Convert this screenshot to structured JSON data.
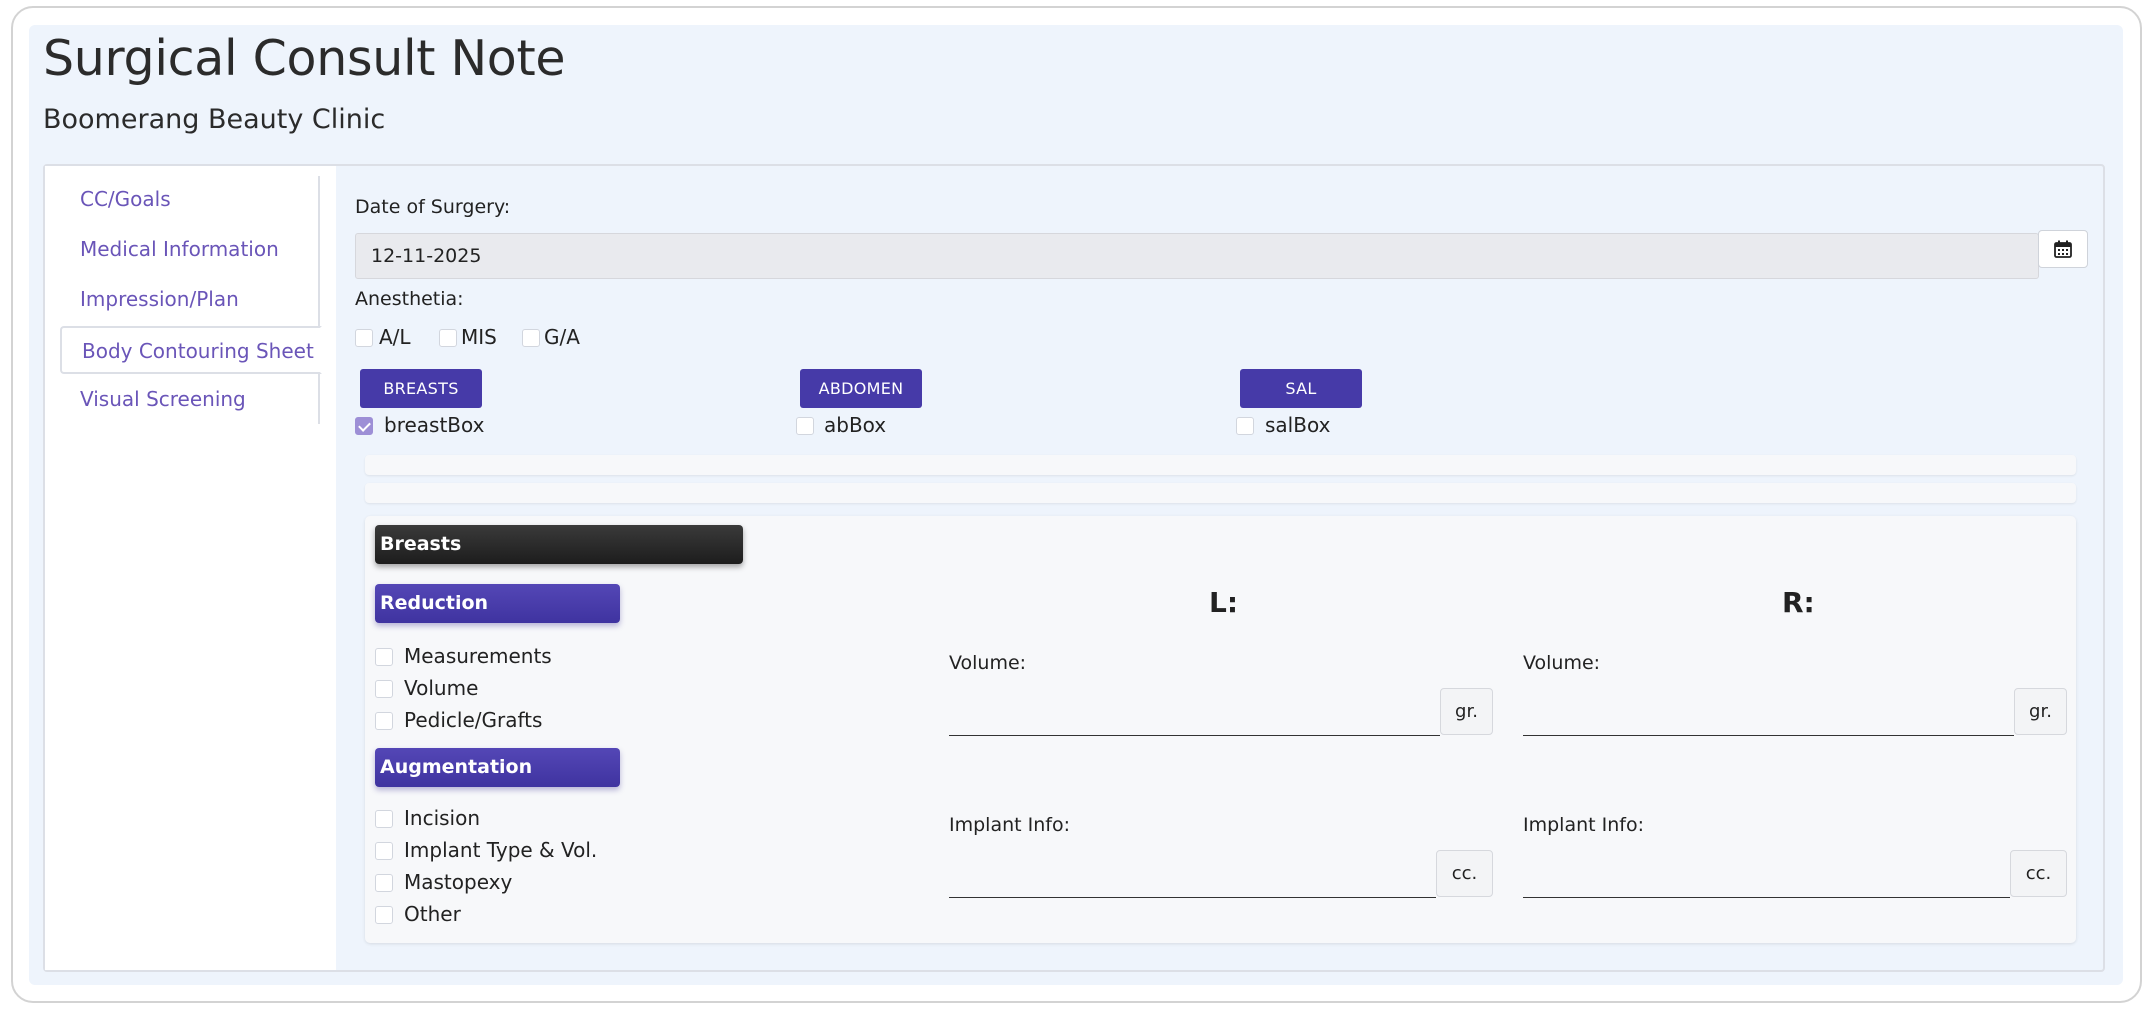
{
  "header": {
    "title": "Surgical Consult Note",
    "clinic": "Boomerang Beauty Clinic"
  },
  "sidebar": {
    "items": [
      {
        "label": "CC/Goals",
        "active": false
      },
      {
        "label": "Medical Information",
        "active": false
      },
      {
        "label": "Impression/Plan",
        "active": false
      },
      {
        "label": "Body Contouring Sheet",
        "active": true
      },
      {
        "label": "Visual Screening",
        "active": false
      }
    ]
  },
  "form": {
    "date_of_surgery_label": "Date of Surgery:",
    "date_of_surgery_value": "12-11-2025",
    "calendar_icon": "calendar-icon",
    "anesthesia_label": "Anesthetia:",
    "anesthesia_options": [
      {
        "label": "A/L",
        "checked": false
      },
      {
        "label": "MIS",
        "checked": false
      },
      {
        "label": "G/A",
        "checked": false
      }
    ],
    "sections": [
      {
        "button": "BREASTS",
        "checkbox_label": "breastBox",
        "checked": true
      },
      {
        "button": "ABDOMEN",
        "checkbox_label": "abBox",
        "checked": false
      },
      {
        "button": "SAL",
        "checkbox_label": "salBox",
        "checked": false
      }
    ]
  },
  "breasts": {
    "title": "Breasts",
    "reduction": {
      "title": "Reduction",
      "options": [
        "Measurements",
        "Volume",
        "Pedicle/Grafts"
      ]
    },
    "augmentation": {
      "title": "Augmentation",
      "options": [
        "Incision",
        "Implant Type & Vol.",
        "Mastopexy",
        "Other"
      ]
    },
    "left": {
      "heading": "L:",
      "volume_label": "Volume:",
      "volume_unit": "gr.",
      "volume_value": "",
      "implant_label": "Implant Info:",
      "implant_unit": "cc.",
      "implant_value": ""
    },
    "right": {
      "heading": "R:",
      "volume_label": "Volume:",
      "volume_unit": "gr.",
      "volume_value": "",
      "implant_label": "Implant Info:",
      "implant_unit": "cc.",
      "implant_value": ""
    }
  },
  "colors": {
    "accent": "#463aa8",
    "nav_link": "#6a55b8",
    "background": "#eef4fc",
    "checkbox_checked": "#9d8fd6"
  }
}
